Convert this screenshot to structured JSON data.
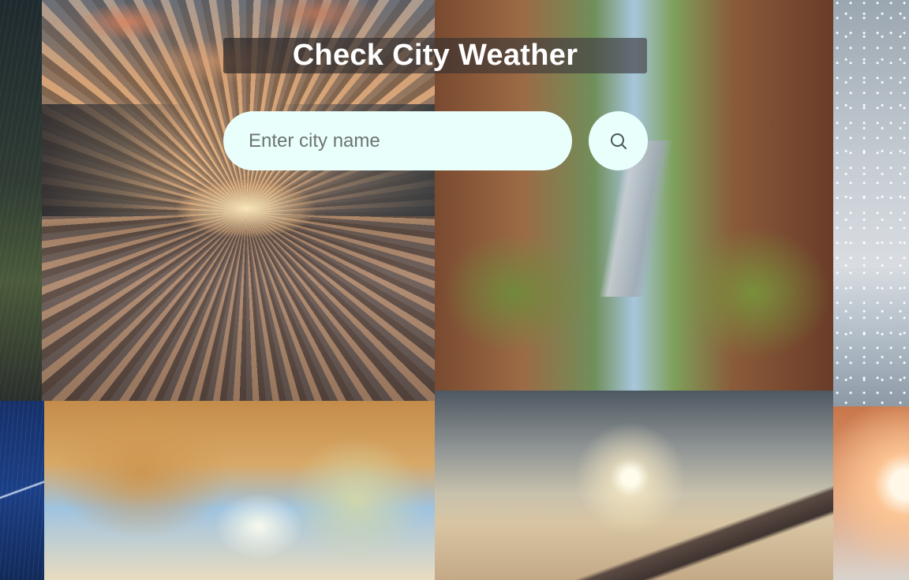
{
  "page": {
    "title": "Check City Weather"
  },
  "search": {
    "placeholder": "Enter city name",
    "value": "",
    "button_icon": "search-icon"
  },
  "background": {
    "tiles": [
      {
        "name": "rain"
      },
      {
        "name": "sunset-road"
      },
      {
        "name": "village-path"
      },
      {
        "name": "snow"
      },
      {
        "name": "lightning"
      },
      {
        "name": "autumn-trees"
      },
      {
        "name": "desert"
      },
      {
        "name": "sun-burst"
      }
    ]
  },
  "colors": {
    "input_bg": "#e9fffc",
    "title_text": "#ffffff",
    "placeholder": "#6e7470"
  }
}
